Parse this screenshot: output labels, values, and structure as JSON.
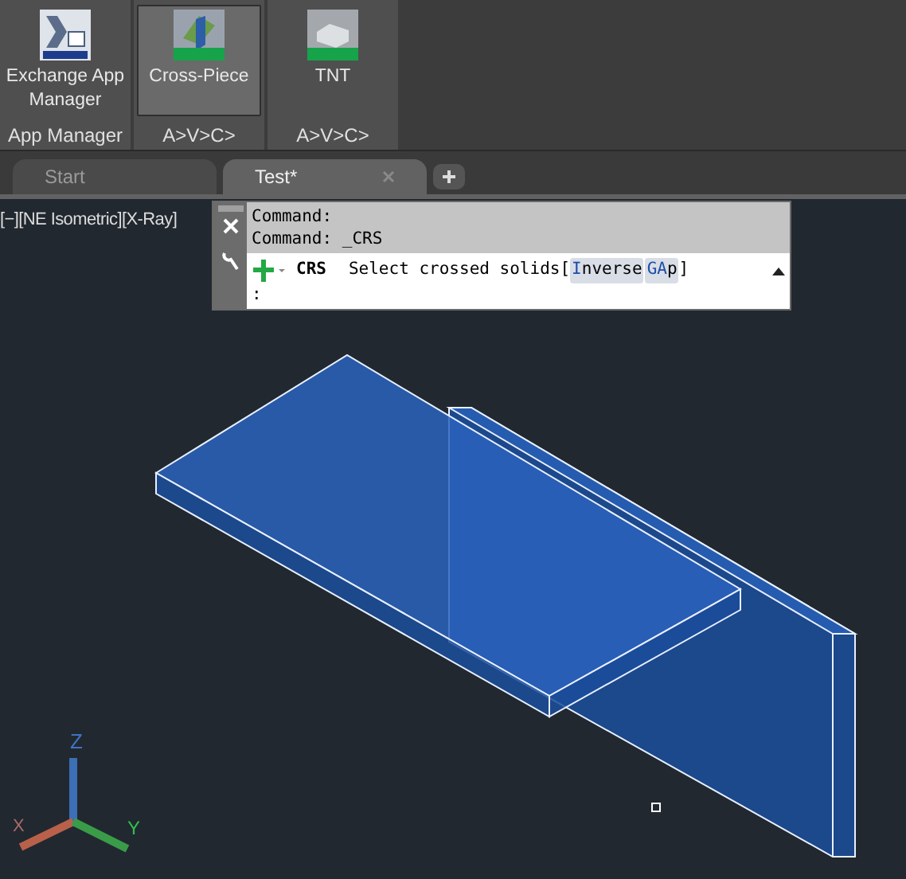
{
  "ribbon": {
    "panels": [
      {
        "kind": "exchange",
        "buttons": [
          {
            "label": "Exchange App Manager",
            "selected": false
          }
        ],
        "title": "App Manager"
      },
      {
        "kind": "cross",
        "buttons": [
          {
            "label": "Cross-Piece",
            "selected": true
          }
        ],
        "title": "A>V>C>"
      },
      {
        "kind": "tnt",
        "buttons": [
          {
            "label": "TNT",
            "selected": false
          }
        ],
        "title": "A>V>C>"
      }
    ]
  },
  "file_tabs": [
    {
      "label": "Start",
      "selected": false
    },
    {
      "label": "Test*",
      "selected": true
    }
  ],
  "viewport": {
    "controls": "[−][NE Isometric][X-Ray]",
    "axes": {
      "x": "X",
      "y": "Y",
      "z": "Z"
    }
  },
  "command_window": {
    "history": [
      "Command:",
      "Command: _CRS"
    ],
    "command": "CRS",
    "prompt": "Select crossed solids[",
    "options": [
      {
        "key": "I",
        "rest": "nverse"
      },
      {
        "key": "GA",
        "rest": "p"
      }
    ],
    "closing": "]",
    "input": ":"
  }
}
